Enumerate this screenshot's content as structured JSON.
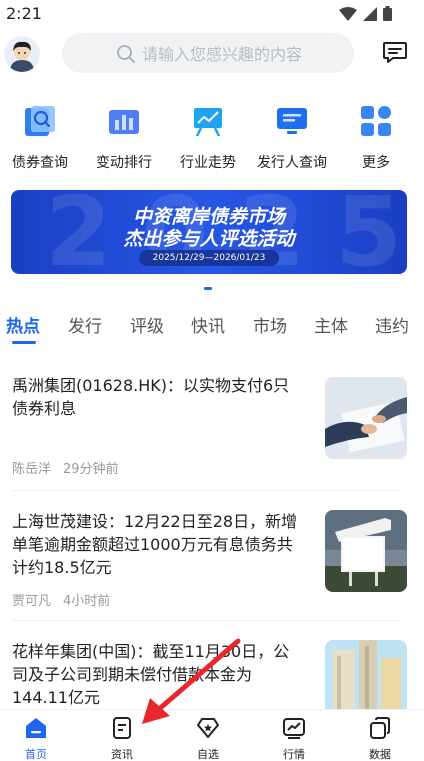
{
  "status_bar": {
    "time": "2:21"
  },
  "header": {
    "search_placeholder": "请输入您感兴趣的内容"
  },
  "quick_nav": [
    {
      "label": "债券查询",
      "icon": "bond-search-icon"
    },
    {
      "label": "变动排行",
      "icon": "ranking-chart-icon"
    },
    {
      "label": "行业走势",
      "icon": "trend-board-icon"
    },
    {
      "label": "发行人查询",
      "icon": "issuer-monitor-icon"
    },
    {
      "label": "更多",
      "icon": "more-grid-icon"
    }
  ],
  "banner": {
    "title_line1": "中资离岸债券市场",
    "title_line2": "杰出参与人评选活动",
    "date_range": "2025/12/29—2026/01/23",
    "bg_text": "2025"
  },
  "tabs": [
    "热点",
    "发行",
    "评级",
    "快讯",
    "市场",
    "主体",
    "违约"
  ],
  "active_tab": "热点",
  "news": [
    {
      "title": "禹洲集团(01628.HK)：以实物支付6只债券利息",
      "author": "陈岳洋",
      "time": "29分钟前"
    },
    {
      "title": "上海世茂建设：12月22日至28日，新增单笔逾期金额超过1000万元有息债务共计约18.5亿元",
      "author": "贾可凡",
      "time": "4小时前"
    },
    {
      "title": "花样年集团(中国)：截至11月30日，公司及子公司到期未偿付借款本金为144.11亿元",
      "author": "",
      "time": ""
    }
  ],
  "bottom_nav": [
    {
      "label": "首页",
      "icon": "home-icon"
    },
    {
      "label": "资讯",
      "icon": "news-icon"
    },
    {
      "label": "自选",
      "icon": "favorite-icon"
    },
    {
      "label": "行情",
      "icon": "market-chart-icon"
    },
    {
      "label": "数据",
      "icon": "data-copy-icon"
    }
  ],
  "colors": {
    "accent": "#1e66f5",
    "banner": "#2757e6",
    "annotation_arrow": "#e8262b"
  }
}
